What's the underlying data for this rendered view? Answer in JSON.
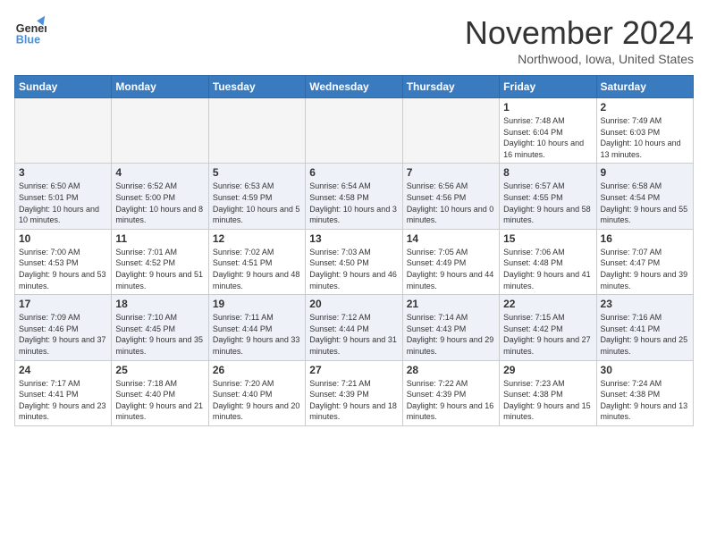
{
  "logo": {
    "line1": "General",
    "line2": "Blue"
  },
  "title": "November 2024",
  "location": "Northwood, Iowa, United States",
  "weekdays": [
    "Sunday",
    "Monday",
    "Tuesday",
    "Wednesday",
    "Thursday",
    "Friday",
    "Saturday"
  ],
  "weeks": [
    [
      {
        "day": "",
        "info": ""
      },
      {
        "day": "",
        "info": ""
      },
      {
        "day": "",
        "info": ""
      },
      {
        "day": "",
        "info": ""
      },
      {
        "day": "",
        "info": ""
      },
      {
        "day": "1",
        "info": "Sunrise: 7:48 AM\nSunset: 6:04 PM\nDaylight: 10 hours and 16 minutes."
      },
      {
        "day": "2",
        "info": "Sunrise: 7:49 AM\nSunset: 6:03 PM\nDaylight: 10 hours and 13 minutes."
      }
    ],
    [
      {
        "day": "3",
        "info": "Sunrise: 6:50 AM\nSunset: 5:01 PM\nDaylight: 10 hours and 10 minutes."
      },
      {
        "day": "4",
        "info": "Sunrise: 6:52 AM\nSunset: 5:00 PM\nDaylight: 10 hours and 8 minutes."
      },
      {
        "day": "5",
        "info": "Sunrise: 6:53 AM\nSunset: 4:59 PM\nDaylight: 10 hours and 5 minutes."
      },
      {
        "day": "6",
        "info": "Sunrise: 6:54 AM\nSunset: 4:58 PM\nDaylight: 10 hours and 3 minutes."
      },
      {
        "day": "7",
        "info": "Sunrise: 6:56 AM\nSunset: 4:56 PM\nDaylight: 10 hours and 0 minutes."
      },
      {
        "day": "8",
        "info": "Sunrise: 6:57 AM\nSunset: 4:55 PM\nDaylight: 9 hours and 58 minutes."
      },
      {
        "day": "9",
        "info": "Sunrise: 6:58 AM\nSunset: 4:54 PM\nDaylight: 9 hours and 55 minutes."
      }
    ],
    [
      {
        "day": "10",
        "info": "Sunrise: 7:00 AM\nSunset: 4:53 PM\nDaylight: 9 hours and 53 minutes."
      },
      {
        "day": "11",
        "info": "Sunrise: 7:01 AM\nSunset: 4:52 PM\nDaylight: 9 hours and 51 minutes."
      },
      {
        "day": "12",
        "info": "Sunrise: 7:02 AM\nSunset: 4:51 PM\nDaylight: 9 hours and 48 minutes."
      },
      {
        "day": "13",
        "info": "Sunrise: 7:03 AM\nSunset: 4:50 PM\nDaylight: 9 hours and 46 minutes."
      },
      {
        "day": "14",
        "info": "Sunrise: 7:05 AM\nSunset: 4:49 PM\nDaylight: 9 hours and 44 minutes."
      },
      {
        "day": "15",
        "info": "Sunrise: 7:06 AM\nSunset: 4:48 PM\nDaylight: 9 hours and 41 minutes."
      },
      {
        "day": "16",
        "info": "Sunrise: 7:07 AM\nSunset: 4:47 PM\nDaylight: 9 hours and 39 minutes."
      }
    ],
    [
      {
        "day": "17",
        "info": "Sunrise: 7:09 AM\nSunset: 4:46 PM\nDaylight: 9 hours and 37 minutes."
      },
      {
        "day": "18",
        "info": "Sunrise: 7:10 AM\nSunset: 4:45 PM\nDaylight: 9 hours and 35 minutes."
      },
      {
        "day": "19",
        "info": "Sunrise: 7:11 AM\nSunset: 4:44 PM\nDaylight: 9 hours and 33 minutes."
      },
      {
        "day": "20",
        "info": "Sunrise: 7:12 AM\nSunset: 4:44 PM\nDaylight: 9 hours and 31 minutes."
      },
      {
        "day": "21",
        "info": "Sunrise: 7:14 AM\nSunset: 4:43 PM\nDaylight: 9 hours and 29 minutes."
      },
      {
        "day": "22",
        "info": "Sunrise: 7:15 AM\nSunset: 4:42 PM\nDaylight: 9 hours and 27 minutes."
      },
      {
        "day": "23",
        "info": "Sunrise: 7:16 AM\nSunset: 4:41 PM\nDaylight: 9 hours and 25 minutes."
      }
    ],
    [
      {
        "day": "24",
        "info": "Sunrise: 7:17 AM\nSunset: 4:41 PM\nDaylight: 9 hours and 23 minutes."
      },
      {
        "day": "25",
        "info": "Sunrise: 7:18 AM\nSunset: 4:40 PM\nDaylight: 9 hours and 21 minutes."
      },
      {
        "day": "26",
        "info": "Sunrise: 7:20 AM\nSunset: 4:40 PM\nDaylight: 9 hours and 20 minutes."
      },
      {
        "day": "27",
        "info": "Sunrise: 7:21 AM\nSunset: 4:39 PM\nDaylight: 9 hours and 18 minutes."
      },
      {
        "day": "28",
        "info": "Sunrise: 7:22 AM\nSunset: 4:39 PM\nDaylight: 9 hours and 16 minutes."
      },
      {
        "day": "29",
        "info": "Sunrise: 7:23 AM\nSunset: 4:38 PM\nDaylight: 9 hours and 15 minutes."
      },
      {
        "day": "30",
        "info": "Sunrise: 7:24 AM\nSunset: 4:38 PM\nDaylight: 9 hours and 13 minutes."
      }
    ]
  ]
}
